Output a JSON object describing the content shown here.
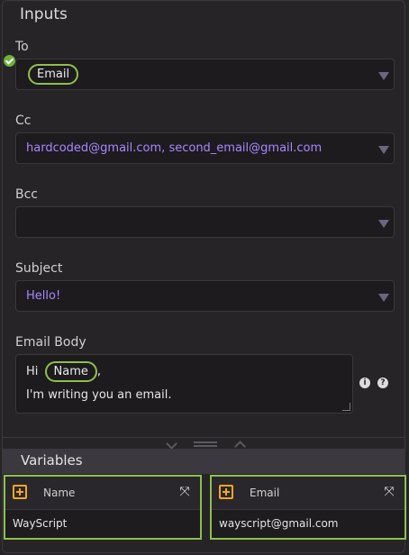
{
  "inputs": {
    "title": "Inputs",
    "to": {
      "label": "To",
      "chip": "Email"
    },
    "cc": {
      "label": "Cc",
      "value": "hardcoded@gmail.com, second_email@gmail.com"
    },
    "bcc": {
      "label": "Bcc",
      "value": ""
    },
    "subject": {
      "label": "Subject",
      "value": "Hello!"
    },
    "email_body": {
      "label": "Email Body",
      "prefix": "Hi",
      "chip": "Name",
      "suffix": ",",
      "line2": "I'm writing you an email."
    }
  },
  "variables": {
    "title": "Variables",
    "items": [
      {
        "name": "Name",
        "value": "WayScript"
      },
      {
        "name": "Email",
        "value": "wayscript@gmail.com"
      }
    ]
  },
  "colors": {
    "accent_green": "#8ec04a",
    "value_purple": "#a987ff",
    "plus_orange": "#f5a623"
  }
}
